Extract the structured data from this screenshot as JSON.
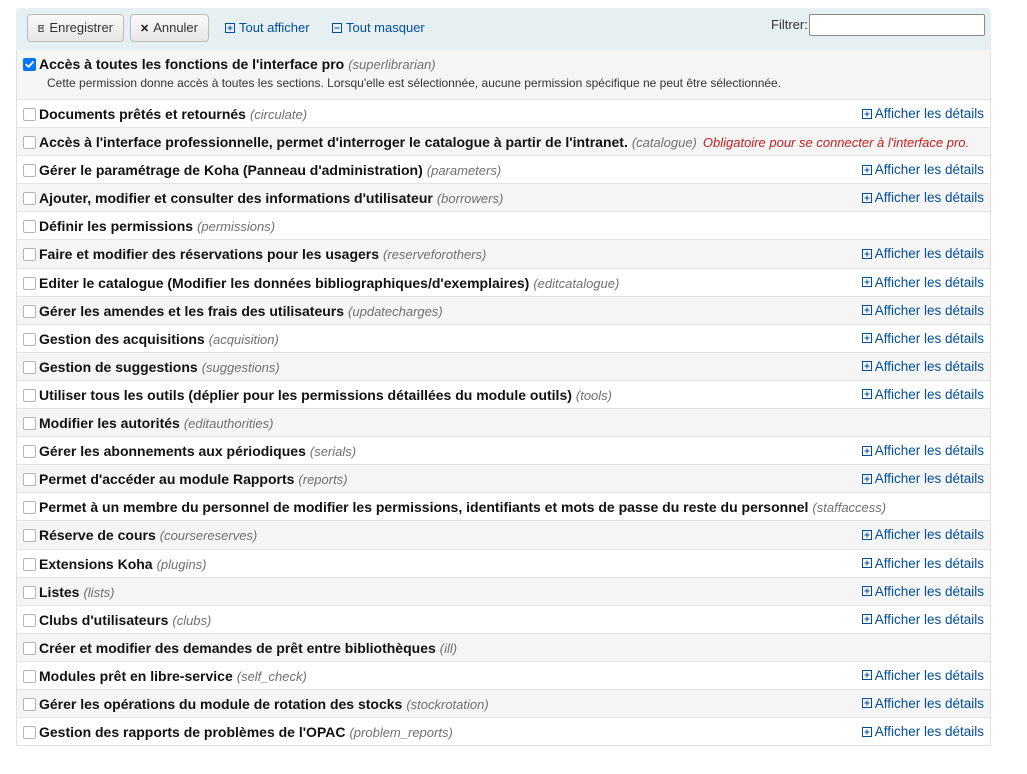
{
  "toolbar": {
    "save_label": "Enregistrer",
    "cancel_label": "Annuler",
    "expand_all_label": "Tout afficher",
    "collapse_all_label": "Tout masquer",
    "filter_label": "Filtrer:",
    "filter_value": ""
  },
  "superlibrarian": {
    "label": "Accès à toutes les fonctions de l'interface pro",
    "code": "(superlibrarian)",
    "description": "Cette permission donne accès à toutes les sections. Lorsqu'elle est sélectionnée, aucune permission spécifique ne peut être sélectionnée.",
    "checked": true
  },
  "details_label": "Afficher les détails",
  "permissions": [
    {
      "label": "Documents prêtés et retournés",
      "code": "(circulate)",
      "details": true,
      "note": ""
    },
    {
      "label": "Accès à l'interface professionnelle, permet d'interroger le catalogue à partir de l'intranet.",
      "code": "(catalogue)",
      "details": false,
      "note": "Obligatoire pour se connecter à l'interface pro."
    },
    {
      "label": "Gérer le paramétrage de Koha (Panneau d'administration)",
      "code": "(parameters)",
      "details": true,
      "note": ""
    },
    {
      "label": "Ajouter, modifier et consulter des informations d'utilisateur",
      "code": "(borrowers)",
      "details": true,
      "note": ""
    },
    {
      "label": "Définir les permissions",
      "code": "(permissions)",
      "details": false,
      "note": ""
    },
    {
      "label": "Faire et modifier des réservations pour les usagers",
      "code": "(reserveforothers)",
      "details": true,
      "note": ""
    },
    {
      "label": "Editer le catalogue (Modifier les données bibliographiques/d'exemplaires)",
      "code": "(editcatalogue)",
      "details": true,
      "note": ""
    },
    {
      "label": "Gérer les amendes et les frais des utilisateurs",
      "code": "(updatecharges)",
      "details": true,
      "note": ""
    },
    {
      "label": "Gestion des acquisitions",
      "code": "(acquisition)",
      "details": true,
      "note": ""
    },
    {
      "label": "Gestion de suggestions",
      "code": "(suggestions)",
      "details": true,
      "note": ""
    },
    {
      "label": "Utiliser tous les outils (déplier pour les permissions détaillées du module outils)",
      "code": "(tools)",
      "details": true,
      "note": ""
    },
    {
      "label": "Modifier les autorités",
      "code": "(editauthorities)",
      "details": false,
      "note": ""
    },
    {
      "label": "Gérer les abonnements aux périodiques",
      "code": "(serials)",
      "details": true,
      "note": ""
    },
    {
      "label": "Permet d'accéder au module Rapports",
      "code": "(reports)",
      "details": true,
      "note": ""
    },
    {
      "label": "Permet à un membre du personnel de modifier les permissions, identifiants et mots de passe du reste du personnel",
      "code": "(staffaccess)",
      "details": false,
      "note": ""
    },
    {
      "label": "Réserve de cours",
      "code": "(coursereserves)",
      "details": true,
      "note": ""
    },
    {
      "label": "Extensions Koha",
      "code": "(plugins)",
      "details": true,
      "note": ""
    },
    {
      "label": "Listes",
      "code": "(lists)",
      "details": true,
      "note": ""
    },
    {
      "label": "Clubs d'utilisateurs",
      "code": "(clubs)",
      "details": true,
      "note": ""
    },
    {
      "label": "Créer et modifier des demandes de prêt entre bibliothèques",
      "code": "(ill)",
      "details": false,
      "note": ""
    },
    {
      "label": "Modules prêt en libre-service",
      "code": "(self_check)",
      "details": true,
      "note": ""
    },
    {
      "label": "Gérer les opérations du module de rotation des stocks",
      "code": "(stockrotation)",
      "details": true,
      "note": ""
    },
    {
      "label": "Gestion des rapports de problèmes de l'OPAC",
      "code": "(problem_reports)",
      "details": true,
      "note": ""
    }
  ]
}
